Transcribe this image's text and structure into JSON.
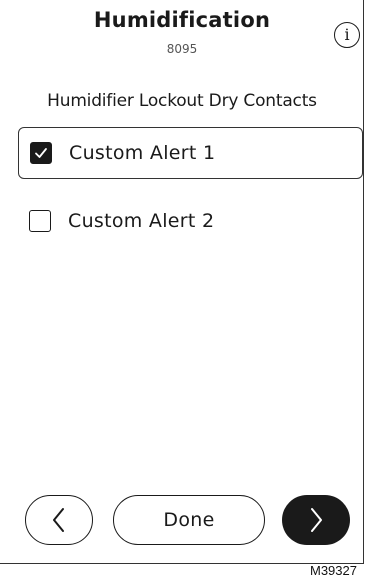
{
  "header": {
    "title": "Humidification",
    "subtitle": "8095",
    "info_icon": "info-icon",
    "info_glyph": "i"
  },
  "section": {
    "heading": "Humidifier Lockout Dry Contacts"
  },
  "options": [
    {
      "label": "Custom Alert 1",
      "checked": true
    },
    {
      "label": "Custom Alert 2",
      "checked": false
    }
  ],
  "footer": {
    "back_icon": "chevron-left-icon",
    "done_label": "Done",
    "next_icon": "chevron-right-icon"
  },
  "figure_code": "M39327",
  "colors": {
    "foreground": "#1a1a1a",
    "background": "#ffffff",
    "primary_button": "#1a1a1a"
  }
}
